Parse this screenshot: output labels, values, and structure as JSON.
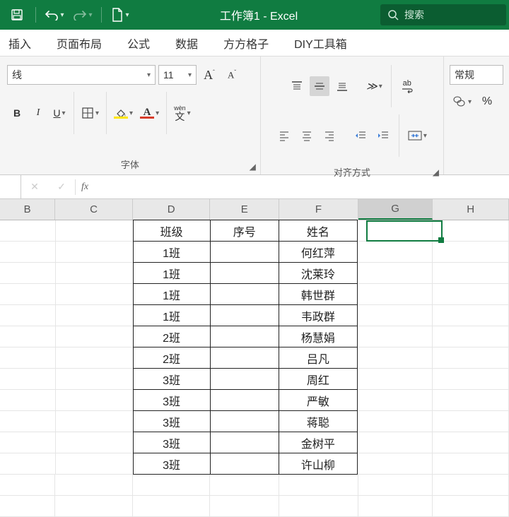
{
  "titlebar": {
    "title": "工作簿1  -  Excel",
    "search_placeholder": "搜索"
  },
  "tabs": [
    "插入",
    "页面布局",
    "公式",
    "数据",
    "方方格子",
    "DIY工具箱"
  ],
  "ribbon": {
    "font_group_label": "字体",
    "align_group_label": "对齐方式",
    "number_group_label": "",
    "font_name": "线",
    "font_size": "11",
    "bold": "B",
    "italic": "I",
    "underline": "U",
    "wen": "wèn",
    "wen_char": "文",
    "number_format": "常规",
    "abc": "ab"
  },
  "formula_bar": {
    "fx": "fx",
    "value": ""
  },
  "columns": [
    "B",
    "C",
    "D",
    "E",
    "F",
    "G",
    "H"
  ],
  "active_cell": {
    "col": "G",
    "row": 1
  },
  "chart_data": {
    "type": "table",
    "headers": [
      "班级",
      "序号",
      "姓名"
    ],
    "rows": [
      [
        "1班",
        "",
        "何红萍"
      ],
      [
        "1班",
        "",
        "沈莱玲"
      ],
      [
        "1班",
        "",
        "韩世群"
      ],
      [
        "1班",
        "",
        "韦政群"
      ],
      [
        "2班",
        "",
        "杨慧娟"
      ],
      [
        "2班",
        "",
        "吕凡"
      ],
      [
        "3班",
        "",
        "周红"
      ],
      [
        "3班",
        "",
        "严敏"
      ],
      [
        "3班",
        "",
        "蒋聪"
      ],
      [
        "3班",
        "",
        "金树平"
      ],
      [
        "3班",
        "",
        "许山柳"
      ]
    ]
  }
}
